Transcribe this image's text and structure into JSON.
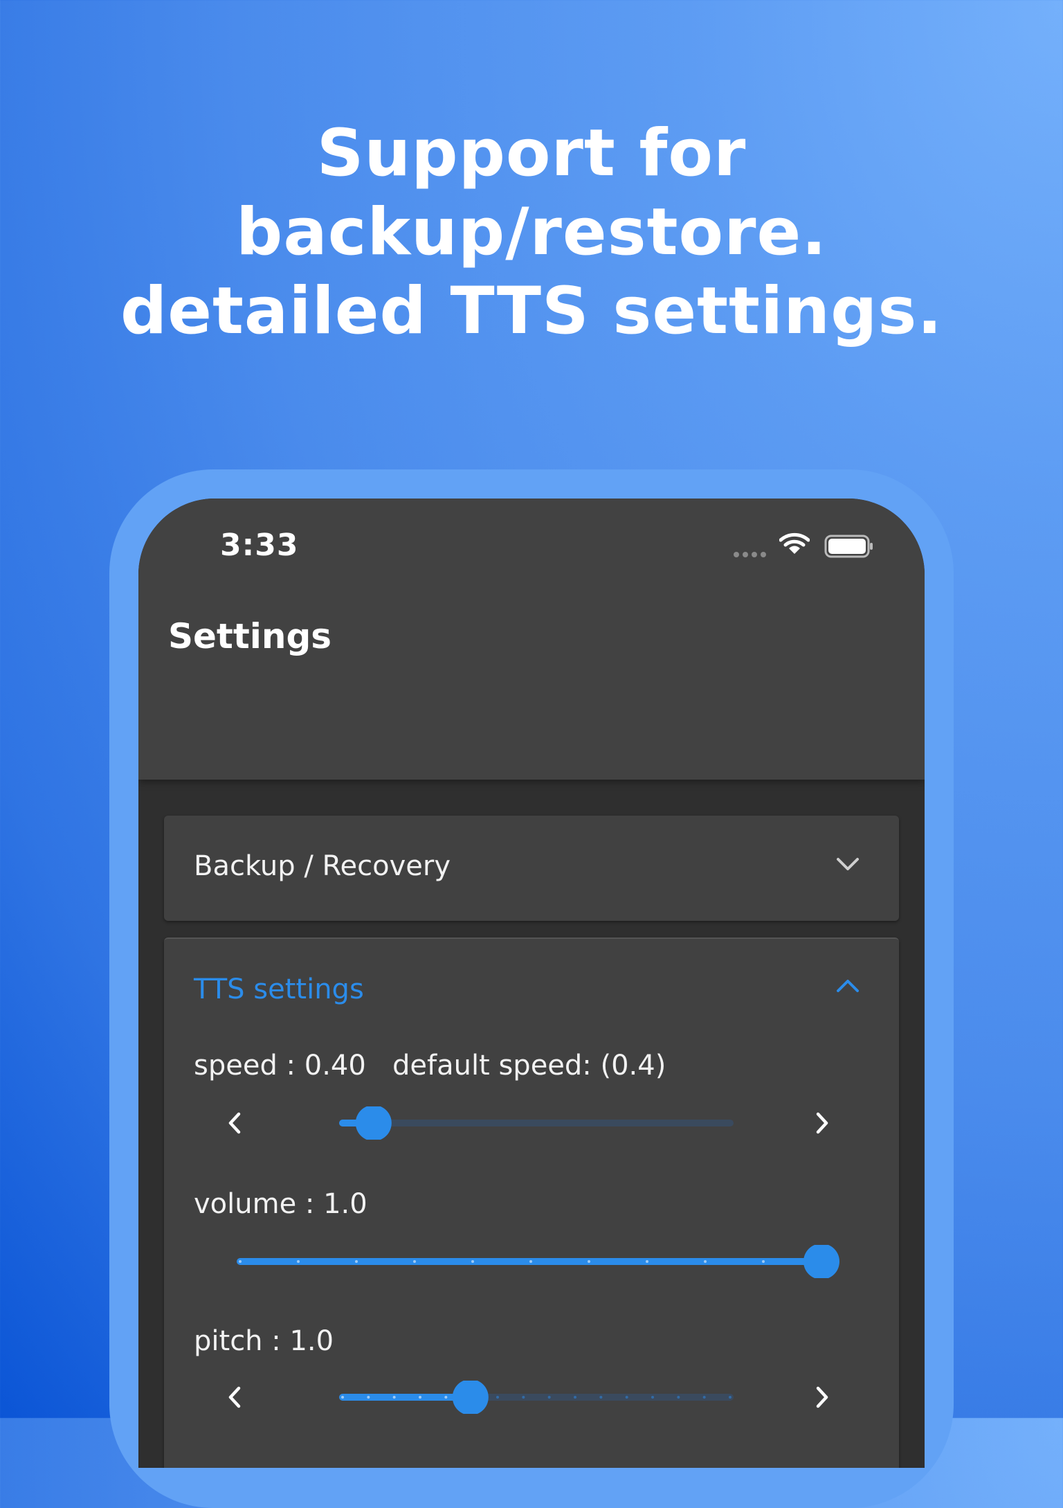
{
  "headline": {
    "line1": "Support for",
    "line2": "backup/restore.",
    "line3": "detailed TTS settings."
  },
  "status_bar": {
    "time": "3:33",
    "icons": [
      "signal-dots-icon",
      "wifi-icon",
      "battery-icon"
    ]
  },
  "app_bar": {
    "title": "Settings"
  },
  "sections": {
    "backup": {
      "label": "Backup / Recovery",
      "icon": "chevron-down-icon",
      "expanded": false
    },
    "tts": {
      "label": "TTS settings",
      "icon": "chevron-up-icon",
      "expanded": true,
      "speed": {
        "label": "speed : 0.40",
        "default_label": "default speed: (0.4)",
        "value": 0.4,
        "fill_fraction": 0.08
      },
      "volume": {
        "label": "volume : 1.0",
        "value": 1.0,
        "fill_fraction": 1.0,
        "divisions": 10
      },
      "pitch": {
        "label": "pitch : 1.0",
        "value": 1.0,
        "fill_fraction": 0.33,
        "divisions": 15
      }
    }
  },
  "colors": {
    "accent": "#2b8cea",
    "track_inactive": "#3a4a5e",
    "app_bar": "#424242",
    "background": "#2f2f2f",
    "panel": "#414141"
  }
}
